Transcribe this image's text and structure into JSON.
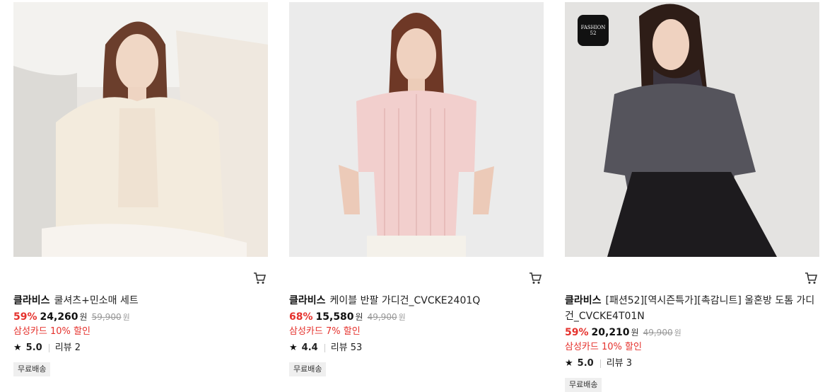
{
  "products": [
    {
      "brand": "클라비스",
      "name": "쿨셔츠+민소매 세트",
      "discount": "59%",
      "price": "24,260",
      "price_unit": "원",
      "original_price": "59,900",
      "original_unit": "원",
      "card_discount": "삼성카드 10% 할인",
      "rating": "5.0",
      "review_label": "리뷰 2",
      "badge": "무료배송"
    },
    {
      "brand": "클라비스",
      "name": "케이블 반팔 가디건_CVCKE2401Q",
      "discount": "68%",
      "price": "15,580",
      "price_unit": "원",
      "original_price": "49,900",
      "original_unit": "원",
      "card_discount": "삼성카드 7% 할인",
      "rating": "4.4",
      "review_label": "리뷰 53",
      "badge": "무료배송"
    },
    {
      "brand": "클라비스",
      "name": "[패션52][역시즌특가][촉감니트] 울혼방 도톰 가디건_CVCKE4T01N",
      "discount": "59%",
      "price": "20,210",
      "price_unit": "원",
      "original_price": "49,900",
      "original_unit": "원",
      "card_discount": "삼성카드 10% 할인",
      "rating": "5.0",
      "review_label": "리뷰 3",
      "badge": "무료배송",
      "logo_text": "FASHION 52"
    }
  ],
  "icons": {
    "cart": "cart-icon",
    "star": "star-icon"
  },
  "colors": {
    "discount_red": "#e5322d",
    "badge_bg": "#efefef"
  }
}
